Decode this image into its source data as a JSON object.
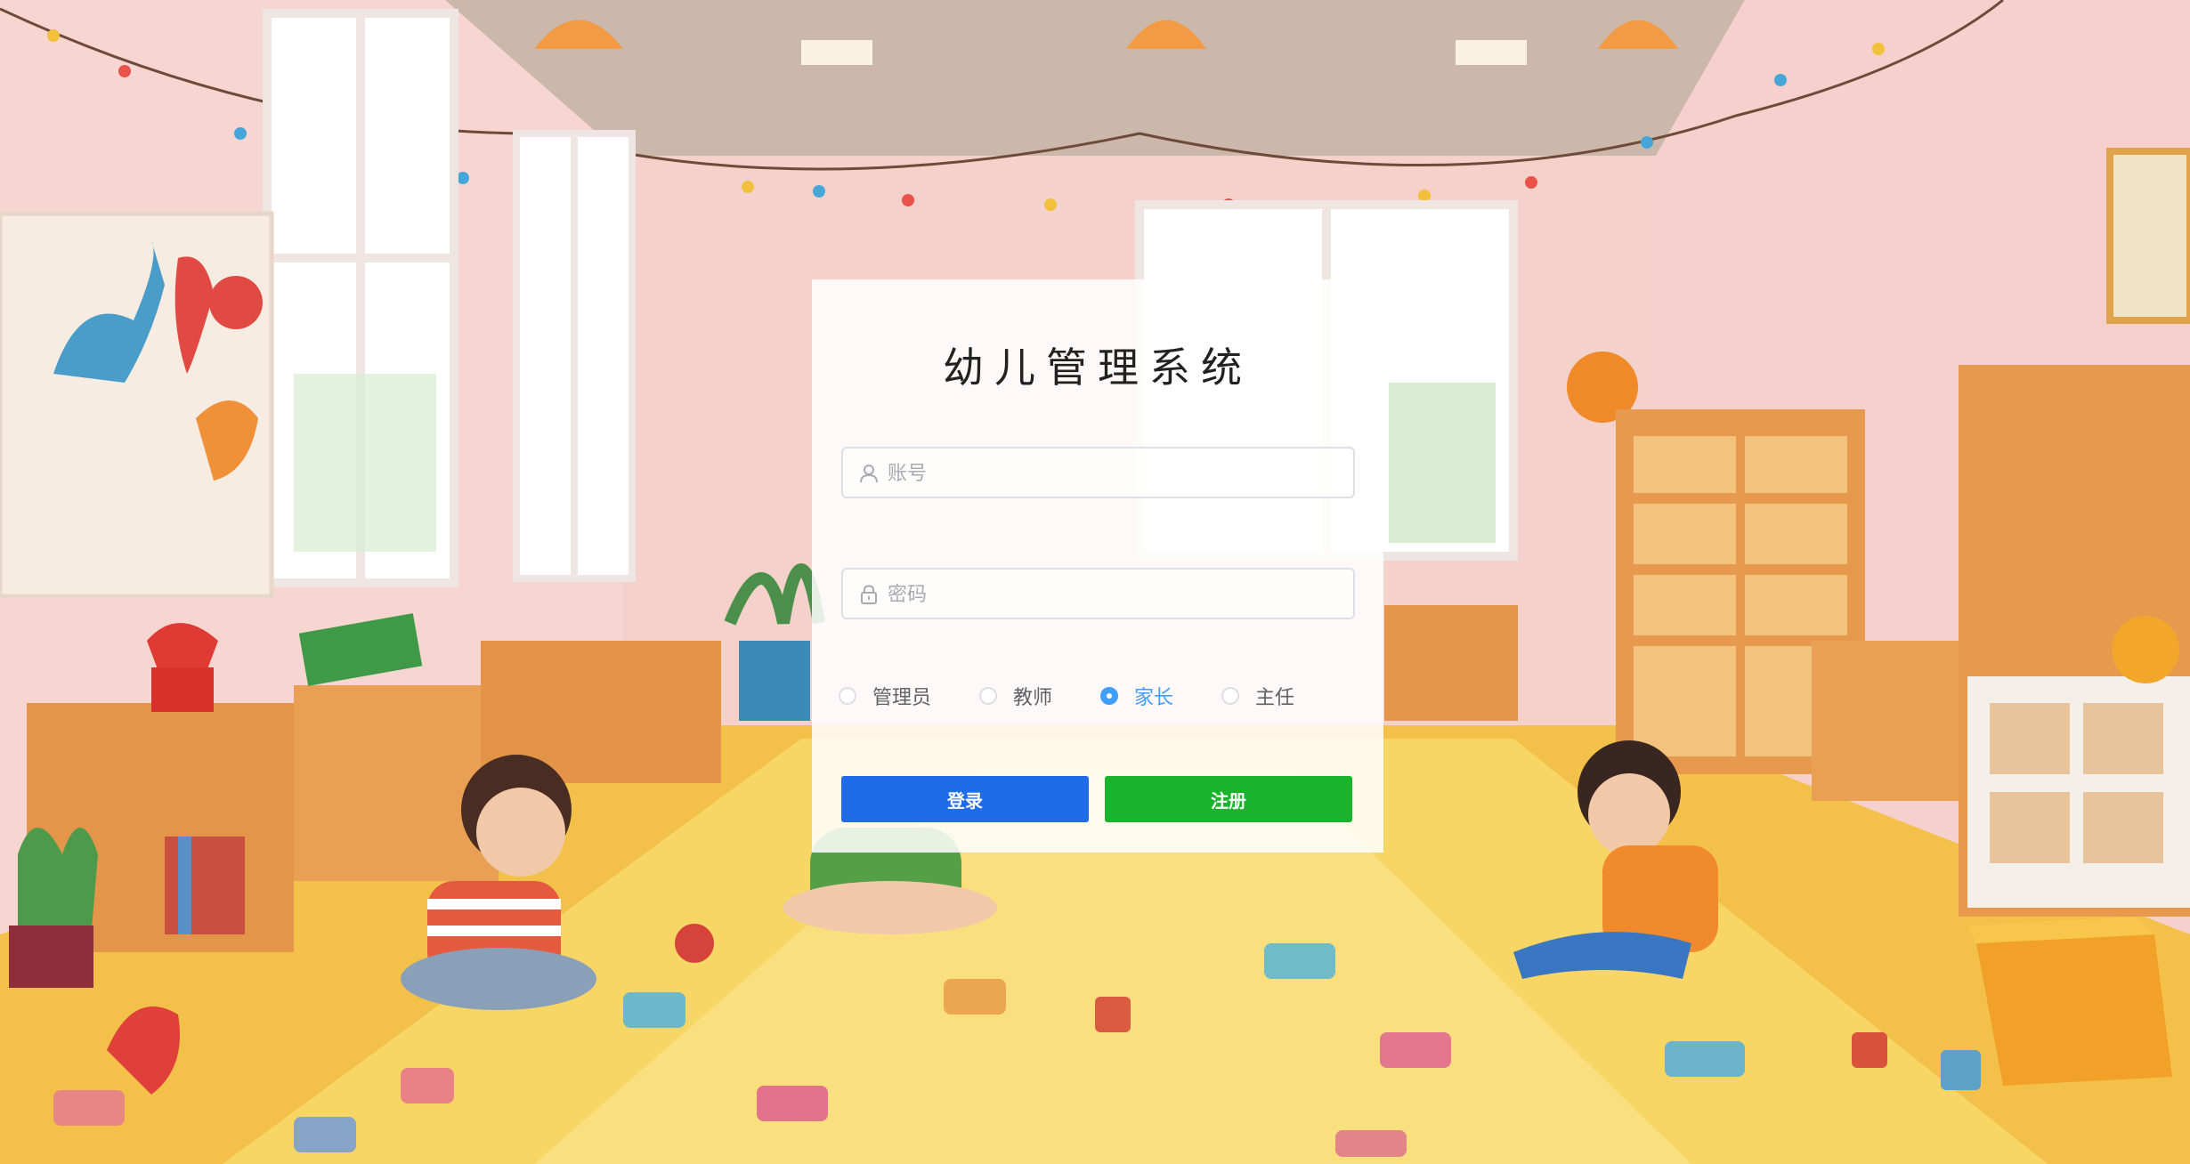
{
  "title": "幼儿管理系统",
  "account_field": {
    "placeholder": "账号",
    "icon": "user-icon"
  },
  "password_field": {
    "placeholder": "密码",
    "icon": "lock-icon"
  },
  "roles": [
    {
      "label": "管理员",
      "checked": false
    },
    {
      "label": "教师",
      "checked": false
    },
    {
      "label": "家长",
      "checked": true
    },
    {
      "label": "主任",
      "checked": false
    }
  ],
  "buttons": {
    "login": "登录",
    "register": "注册"
  },
  "colors": {
    "login_button": "#1f6be8",
    "register_button": "#19b32c",
    "radio_selected": "#409eff"
  }
}
